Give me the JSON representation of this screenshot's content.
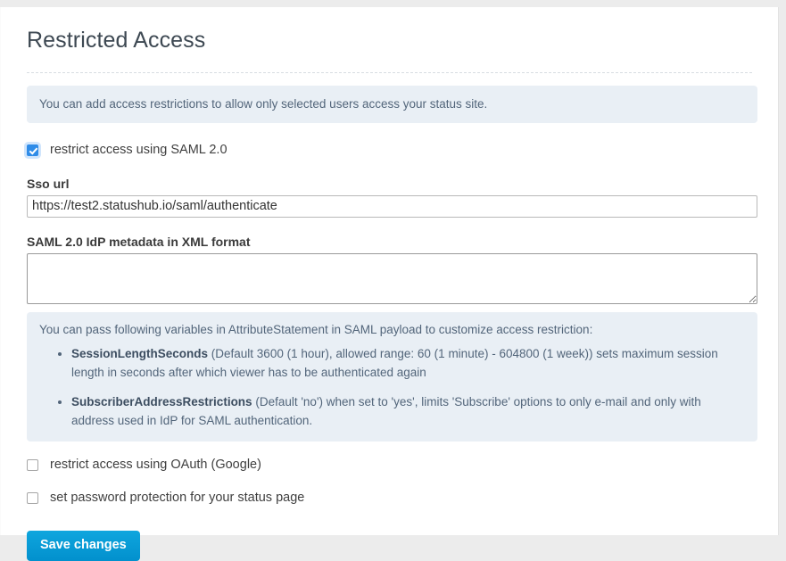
{
  "page": {
    "title": "Restricted Access",
    "intro_alert": "You can add access restrictions to allow only selected users access your status site."
  },
  "saml": {
    "checkbox_label": "restrict access using SAML 2.0",
    "checked": true,
    "sso_url_label": "Sso url",
    "sso_url_value": "https://test2.statushub.io/saml/authenticate",
    "sso_url_placeholder": "",
    "metadata_label": "SAML 2.0 IdP metadata in XML format",
    "metadata_value": "",
    "metadata_placeholder": "",
    "variables_intro": "You can pass following variables in AttributeStatement in SAML payload to customize access restriction:",
    "variables": [
      {
        "name": "SessionLengthSeconds",
        "description": " (Default 3600 (1 hour), allowed range: 60 (1 minute) - 604800 (1 week)) sets maximum session length in seconds after which viewer has to be authenticated again"
      },
      {
        "name": "SubscriberAddressRestrictions",
        "description": " (Default 'no') when set to 'yes', limits 'Subscribe' options to only e-mail and only with address used in IdP for SAML authentication."
      }
    ]
  },
  "oauth": {
    "checkbox_label": "restrict access using OAuth (Google)",
    "checked": false
  },
  "password": {
    "checkbox_label": "set password protection for your status page",
    "checked": false
  },
  "actions": {
    "save_label": "Save changes"
  },
  "colors": {
    "accent": "#0290cd",
    "checkbox_checked": "#2f8ce8",
    "alert_bg": "#e9eff5",
    "alert_text": "#52657a",
    "title_text": "#3d4852"
  }
}
